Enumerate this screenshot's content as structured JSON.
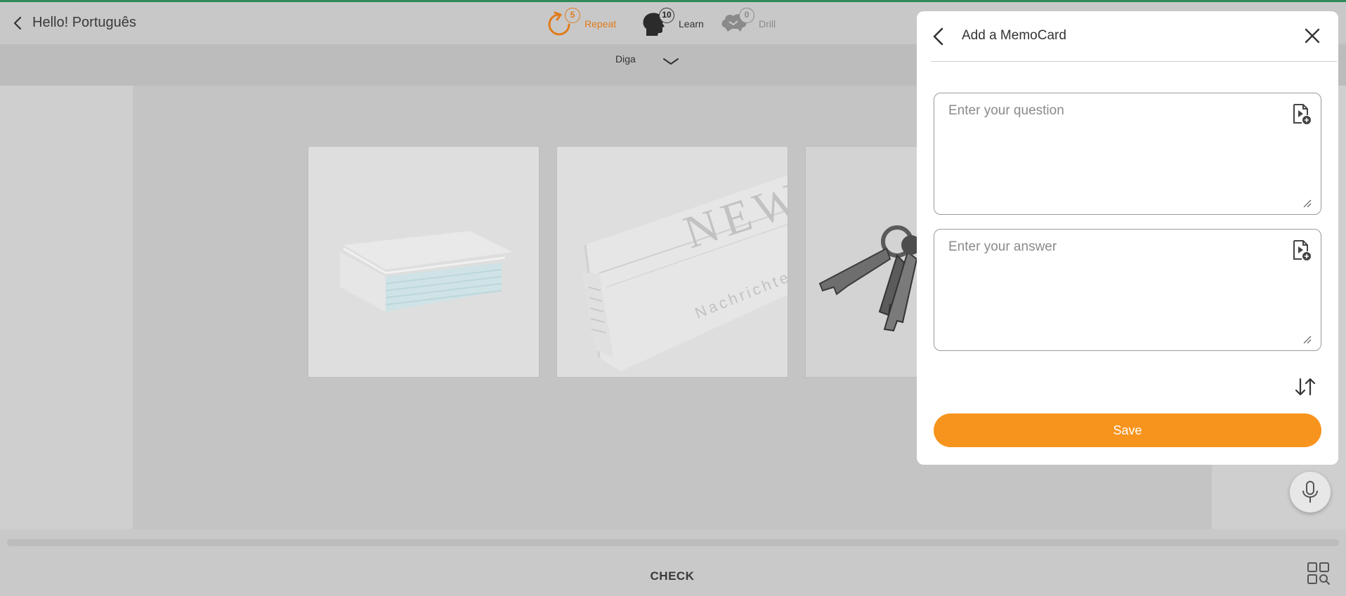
{
  "app": {
    "title": "Hello! Português"
  },
  "modes": [
    {
      "label": "Repeat",
      "count": "5",
      "icon": "repeat-icon"
    },
    {
      "label": "Learn",
      "count": "10",
      "icon": "head-icon"
    },
    {
      "label": "Drill",
      "count": "0",
      "icon": "brain-icon"
    }
  ],
  "prompt": {
    "text": "Diga"
  },
  "cards": [
    {
      "icon": "napkins-image"
    },
    {
      "icon": "newspaper-image",
      "headline": "NEW",
      "subline": "Nachrichten"
    },
    {
      "icon": "keys-image"
    }
  ],
  "panel": {
    "title": "Add a MemoCard",
    "question_placeholder": "Enter your question",
    "answer_placeholder": "Enter your answer",
    "save_label": "Save"
  },
  "bottom": {
    "check_label": "CHECK"
  },
  "colors": {
    "accent": "#f7941d",
    "repeat": "#e07b1a",
    "top_accent": "#2e8b57"
  }
}
